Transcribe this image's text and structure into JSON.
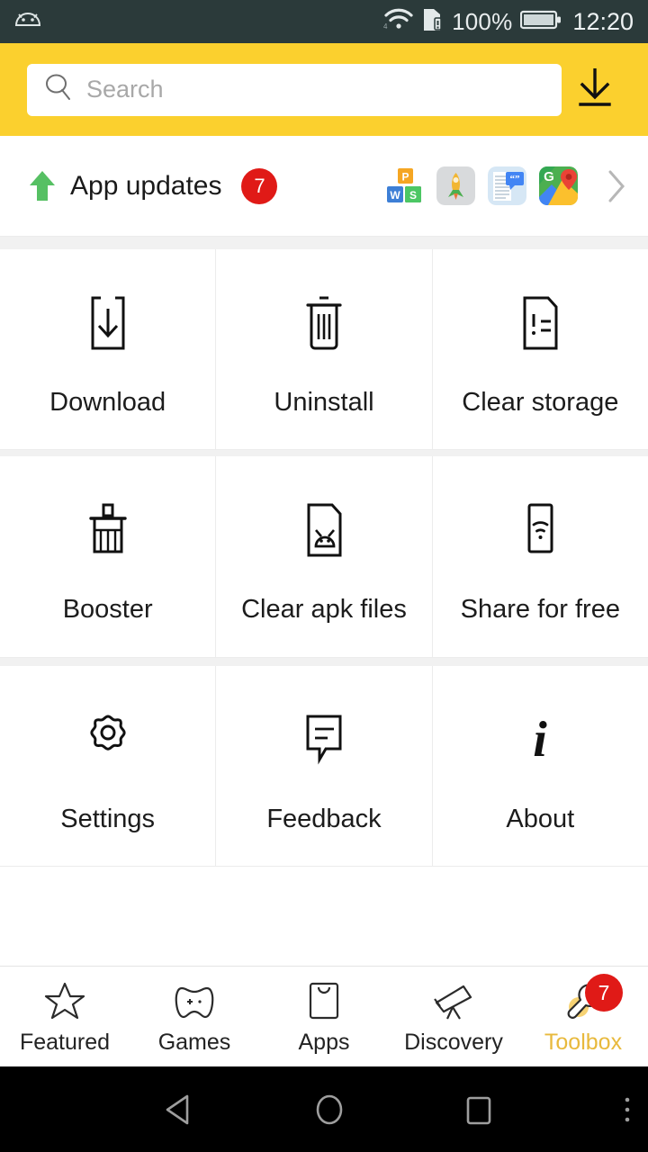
{
  "statusbar": {
    "left_icon": "android-head-icon",
    "wifi_icon": "wifi-icon",
    "sim_icon": "sim-card-icon",
    "battery_percent": "100%",
    "battery_icon": "battery-full-icon",
    "time": "12:20"
  },
  "header": {
    "search_placeholder": "Search",
    "search_icon": "search-icon",
    "download_icon": "download-icon",
    "background_color": "#FBD02E"
  },
  "updates": {
    "arrow_icon": "arrow-up-icon",
    "label": "App updates",
    "badge": "7",
    "badge_color": "#e01a17",
    "chevron_icon": "chevron-right-icon",
    "apps": [
      {
        "name": "wps-office-icon",
        "label": "WPS Office"
      },
      {
        "name": "rocket-app-icon",
        "label": "Rocket"
      },
      {
        "name": "quotes-document-icon",
        "label": "Quotes"
      },
      {
        "name": "google-maps-icon",
        "label": "Maps"
      }
    ]
  },
  "tools": {
    "rows": [
      [
        {
          "icon": "file-download-icon",
          "label": "Download"
        },
        {
          "icon": "trash-icon",
          "label": "Uninstall"
        },
        {
          "icon": "file-warning-icon",
          "label": "Clear storage"
        }
      ],
      [
        {
          "icon": "broom-icon",
          "label": "Booster"
        },
        {
          "icon": "apk-file-icon",
          "label": "Clear apk files"
        },
        {
          "icon": "phone-wifi-icon",
          "label": "Share for free"
        }
      ],
      [
        {
          "icon": "gear-icon",
          "label": "Settings"
        },
        {
          "icon": "speech-bubble-icon",
          "label": "Feedback"
        },
        {
          "icon": "info-icon",
          "label": "About"
        }
      ]
    ]
  },
  "tabs": [
    {
      "icon": "star-icon",
      "label": "Featured",
      "active": false,
      "badge": null
    },
    {
      "icon": "gamepad-icon",
      "label": "Games",
      "active": false,
      "badge": null
    },
    {
      "icon": "shopping-bag-icon",
      "label": "Apps",
      "active": false,
      "badge": null
    },
    {
      "icon": "telescope-icon",
      "label": "Discovery",
      "active": false,
      "badge": null
    },
    {
      "icon": "wrench-icon",
      "label": "Toolbox",
      "active": true,
      "badge": "7"
    }
  ],
  "tabs_active_color": "#E8B93C",
  "navbar": {
    "back_icon": "back-triangle-icon",
    "home_icon": "home-circle-icon",
    "recents_icon": "recents-square-icon",
    "more_icon": "overflow-menu-icon"
  }
}
